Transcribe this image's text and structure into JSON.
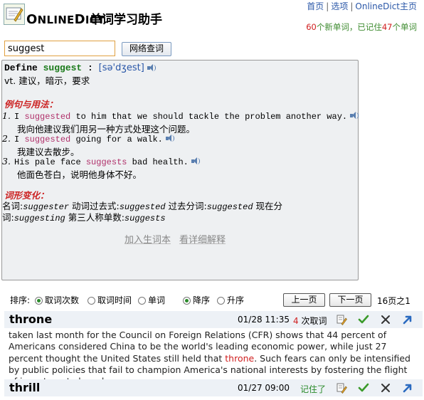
{
  "header": {
    "logo_online": "O",
    "logo_online_rest": "NLINE",
    "logo_dict": "D",
    "logo_dict_rest": "ICT",
    "app_title": "单词学习助手",
    "links": [
      "首页",
      "选项",
      "OnlineDict主页"
    ],
    "stats_new_count": "60",
    "stats_new_label": "个新单词，已记住",
    "stats_known_count": "47",
    "stats_known_label": "个单词"
  },
  "search": {
    "value": "suggest",
    "button_label": "网络查词"
  },
  "definition": {
    "define_label": "Define",
    "word": "suggest",
    "colon": ":",
    "phonetic": "[sə'dʒest]",
    "meaning": "vt. 建议，暗示，要求",
    "examples_title": "例句与用法：",
    "examples": [
      {
        "num": "1.",
        "en_before": "I ",
        "en_hl": "suggested",
        "en_after": " to him that we should tackle the problem another way.",
        "zh": "我向他建议我们用另一种方式处理这个问题。"
      },
      {
        "num": "2.",
        "en_before": "I ",
        "en_hl": "suggested",
        "en_after": " going for a walk.",
        "zh": "我建议去散步。"
      },
      {
        "num": "3.",
        "en_before": "His pale face ",
        "en_hl": "suggests",
        "en_after": " bad health.",
        "zh": "他面色苍白，说明他身体不好。"
      }
    ],
    "forms_title": "词形变化：",
    "forms_line1_a": "名词:",
    "forms_line1_b": "suggester",
    "forms_line1_c": " 动词过去式:",
    "forms_line1_d": "suggested",
    "forms_line1_e": " 过去分词:",
    "forms_line1_f": "suggested",
    "forms_line1_g": " 现在分",
    "forms_line2_a": "词:",
    "forms_line2_b": "suggesting",
    "forms_line2_c": " 第三人称单数:",
    "forms_line2_d": "suggests",
    "actions": [
      "加入生词本",
      "看详细解释"
    ]
  },
  "sort": {
    "label": "排序:",
    "options": [
      "取词次数",
      "取词时间",
      "单词"
    ],
    "selected_option": "取词次数",
    "order_options": [
      "降序",
      "升序"
    ],
    "selected_order": "降序",
    "prev_label": "上一页",
    "next_label": "下一页",
    "page_info": "16页之1"
  },
  "cards": [
    {
      "word": "throne",
      "time": "01/28 11:35",
      "count": "4",
      "count_label": "次取词",
      "text_before": "taken last month for the Council on Foreign Relations (CFR) shows that 44 percent of Americans considered China to be the world's leading economic power, while just 27 percent thought the United States still held that ",
      "text_hl": "throne",
      "text_after": ". Such fears can only be intensified by public policies that fail to champion America's national interests by fostering the flight of investment abroad."
    },
    {
      "word": "thrill",
      "time": "01/27 09:00",
      "status": "记住了"
    }
  ],
  "colors": {
    "accent_green": "#2a8a2a",
    "accent_red": "#d02020",
    "link_blue": "#2a57a8",
    "highlight_pink": "#b0306a"
  }
}
